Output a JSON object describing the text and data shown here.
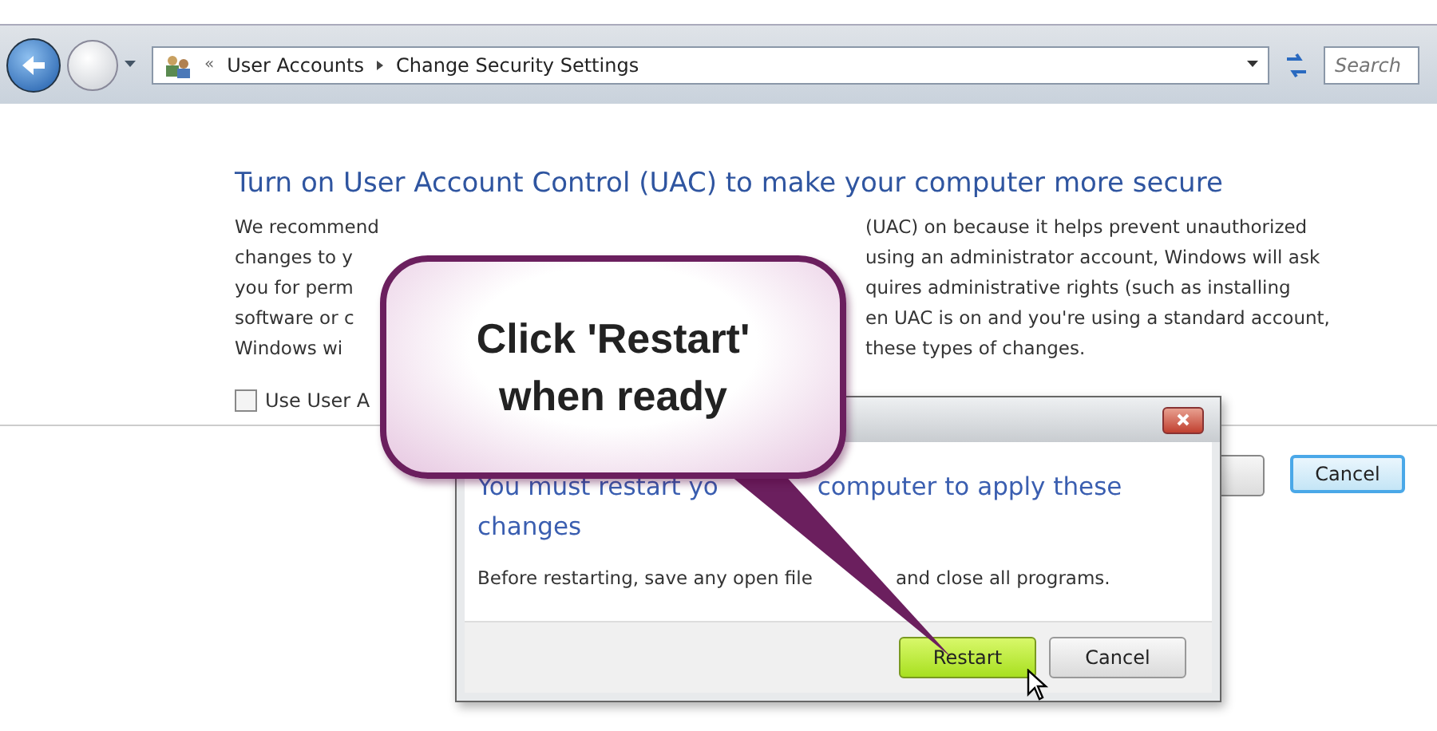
{
  "nav": {
    "overflow": "«",
    "breadcrumb": [
      "User Accounts",
      "Change Security Settings"
    ],
    "search": {
      "placeholder": "Search"
    }
  },
  "page": {
    "heading": "Turn on User Account Control (UAC) to make your computer more secure",
    "paragraph_lines": [
      {
        "left": "We recommend",
        "right": "(UAC) on because it helps prevent unauthorized"
      },
      {
        "left": "changes to y",
        "right": "using an administrator account, Windows will ask"
      },
      {
        "left": "you for perm",
        "right": "quires administrative rights (such as installing"
      },
      {
        "left": "software or c",
        "right": "en UAC is on and you're using a standard account,"
      },
      {
        "left": "Windows wi",
        "right": "these types of changes."
      }
    ],
    "checkbox": {
      "label": "Use User A",
      "checked": false
    },
    "buttons": [
      {
        "label": "Cancel",
        "default": true
      }
    ]
  },
  "dialog": {
    "heading_lines": [
      [
        "You must restart yo",
        "computer to apply these"
      ],
      [
        "changes"
      ]
    ],
    "body": [
      "Before restarting, save any open file",
      "and close all programs."
    ],
    "buttons": [
      {
        "label": "Restart",
        "hovered": true
      },
      {
        "label": "Cancel",
        "hovered": false
      }
    ]
  },
  "callout": {
    "text": "Click 'Restart' when ready"
  }
}
